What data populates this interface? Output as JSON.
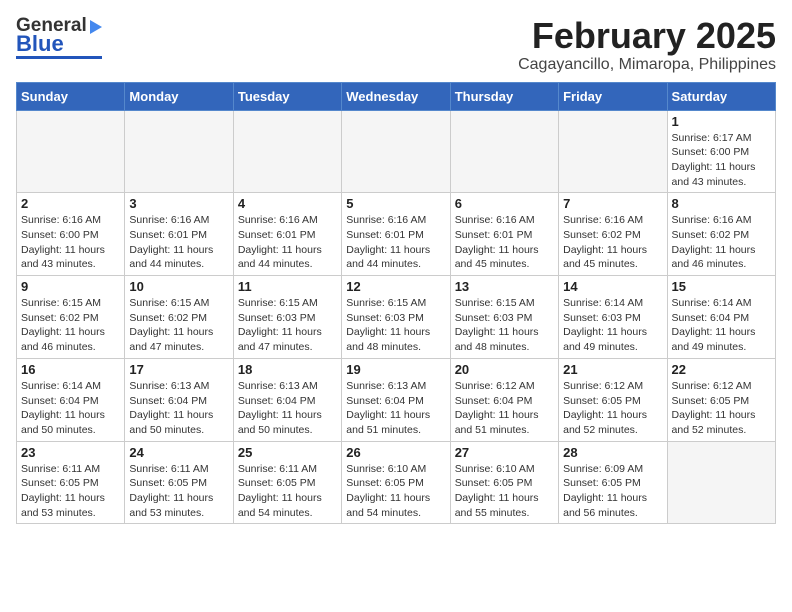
{
  "header": {
    "logo_general": "General",
    "logo_blue": "Blue",
    "title": "February 2025",
    "subtitle": "Cagayancillo, Mimaropa, Philippines"
  },
  "days_of_week": [
    "Sunday",
    "Monday",
    "Tuesday",
    "Wednesday",
    "Thursday",
    "Friday",
    "Saturday"
  ],
  "weeks": [
    [
      {
        "day": "",
        "info": ""
      },
      {
        "day": "",
        "info": ""
      },
      {
        "day": "",
        "info": ""
      },
      {
        "day": "",
        "info": ""
      },
      {
        "day": "",
        "info": ""
      },
      {
        "day": "",
        "info": ""
      },
      {
        "day": "1",
        "info": "Sunrise: 6:17 AM\nSunset: 6:00 PM\nDaylight: 11 hours\nand 43 minutes."
      }
    ],
    [
      {
        "day": "2",
        "info": "Sunrise: 6:16 AM\nSunset: 6:00 PM\nDaylight: 11 hours\nand 43 minutes."
      },
      {
        "day": "3",
        "info": "Sunrise: 6:16 AM\nSunset: 6:01 PM\nDaylight: 11 hours\nand 44 minutes."
      },
      {
        "day": "4",
        "info": "Sunrise: 6:16 AM\nSunset: 6:01 PM\nDaylight: 11 hours\nand 44 minutes."
      },
      {
        "day": "5",
        "info": "Sunrise: 6:16 AM\nSunset: 6:01 PM\nDaylight: 11 hours\nand 44 minutes."
      },
      {
        "day": "6",
        "info": "Sunrise: 6:16 AM\nSunset: 6:01 PM\nDaylight: 11 hours\nand 45 minutes."
      },
      {
        "day": "7",
        "info": "Sunrise: 6:16 AM\nSunset: 6:02 PM\nDaylight: 11 hours\nand 45 minutes."
      },
      {
        "day": "8",
        "info": "Sunrise: 6:16 AM\nSunset: 6:02 PM\nDaylight: 11 hours\nand 46 minutes."
      }
    ],
    [
      {
        "day": "9",
        "info": "Sunrise: 6:15 AM\nSunset: 6:02 PM\nDaylight: 11 hours\nand 46 minutes."
      },
      {
        "day": "10",
        "info": "Sunrise: 6:15 AM\nSunset: 6:02 PM\nDaylight: 11 hours\nand 47 minutes."
      },
      {
        "day": "11",
        "info": "Sunrise: 6:15 AM\nSunset: 6:03 PM\nDaylight: 11 hours\nand 47 minutes."
      },
      {
        "day": "12",
        "info": "Sunrise: 6:15 AM\nSunset: 6:03 PM\nDaylight: 11 hours\nand 48 minutes."
      },
      {
        "day": "13",
        "info": "Sunrise: 6:15 AM\nSunset: 6:03 PM\nDaylight: 11 hours\nand 48 minutes."
      },
      {
        "day": "14",
        "info": "Sunrise: 6:14 AM\nSunset: 6:03 PM\nDaylight: 11 hours\nand 49 minutes."
      },
      {
        "day": "15",
        "info": "Sunrise: 6:14 AM\nSunset: 6:04 PM\nDaylight: 11 hours\nand 49 minutes."
      }
    ],
    [
      {
        "day": "16",
        "info": "Sunrise: 6:14 AM\nSunset: 6:04 PM\nDaylight: 11 hours\nand 50 minutes."
      },
      {
        "day": "17",
        "info": "Sunrise: 6:13 AM\nSunset: 6:04 PM\nDaylight: 11 hours\nand 50 minutes."
      },
      {
        "day": "18",
        "info": "Sunrise: 6:13 AM\nSunset: 6:04 PM\nDaylight: 11 hours\nand 50 minutes."
      },
      {
        "day": "19",
        "info": "Sunrise: 6:13 AM\nSunset: 6:04 PM\nDaylight: 11 hours\nand 51 minutes."
      },
      {
        "day": "20",
        "info": "Sunrise: 6:12 AM\nSunset: 6:04 PM\nDaylight: 11 hours\nand 51 minutes."
      },
      {
        "day": "21",
        "info": "Sunrise: 6:12 AM\nSunset: 6:05 PM\nDaylight: 11 hours\nand 52 minutes."
      },
      {
        "day": "22",
        "info": "Sunrise: 6:12 AM\nSunset: 6:05 PM\nDaylight: 11 hours\nand 52 minutes."
      }
    ],
    [
      {
        "day": "23",
        "info": "Sunrise: 6:11 AM\nSunset: 6:05 PM\nDaylight: 11 hours\nand 53 minutes."
      },
      {
        "day": "24",
        "info": "Sunrise: 6:11 AM\nSunset: 6:05 PM\nDaylight: 11 hours\nand 53 minutes."
      },
      {
        "day": "25",
        "info": "Sunrise: 6:11 AM\nSunset: 6:05 PM\nDaylight: 11 hours\nand 54 minutes."
      },
      {
        "day": "26",
        "info": "Sunrise: 6:10 AM\nSunset: 6:05 PM\nDaylight: 11 hours\nand 54 minutes."
      },
      {
        "day": "27",
        "info": "Sunrise: 6:10 AM\nSunset: 6:05 PM\nDaylight: 11 hours\nand 55 minutes."
      },
      {
        "day": "28",
        "info": "Sunrise: 6:09 AM\nSunset: 6:05 PM\nDaylight: 11 hours\nand 56 minutes."
      },
      {
        "day": "",
        "info": ""
      }
    ]
  ]
}
